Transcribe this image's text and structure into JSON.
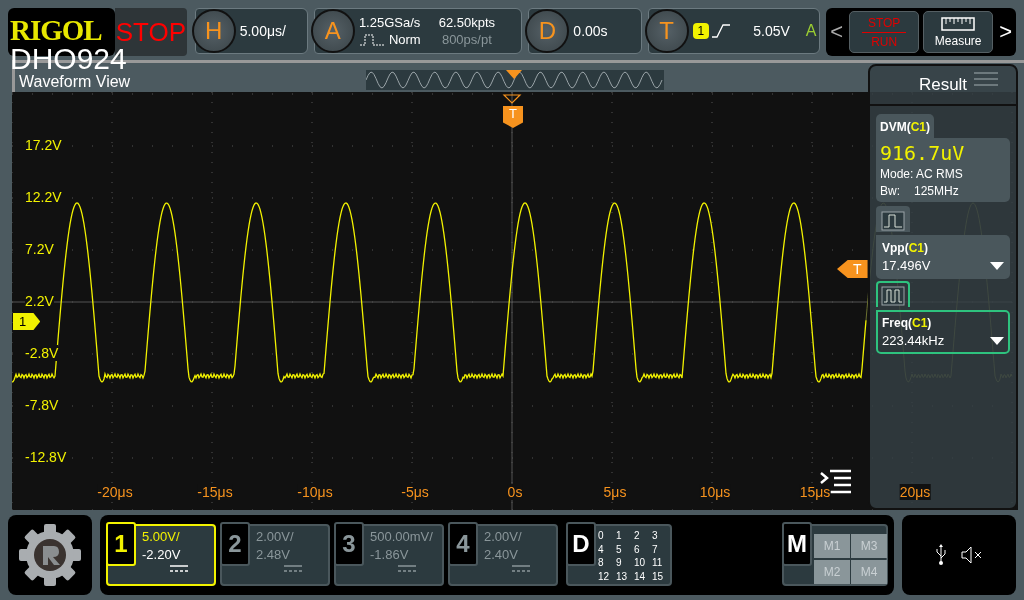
{
  "header": {
    "logo": "RIGOL",
    "model": "DHO924",
    "run_state": "STOP"
  },
  "horizontal": {
    "label": "H",
    "scale": "5.00μs/"
  },
  "acquire": {
    "label": "A",
    "sample_rate": "1.25GSa/s",
    "mode": "Norm",
    "memory": "62.50kpts",
    "resolution": "800ps/pt"
  },
  "delay": {
    "label": "D",
    "offset": "0.00s"
  },
  "trigger": {
    "label": "T",
    "source": "1",
    "level": "5.05V",
    "sweep": "A"
  },
  "quick": {
    "prev": "<",
    "next": ">",
    "buttons": [
      {
        "kind": "stop-run",
        "top": "STOP",
        "bottom": "RUN"
      },
      {
        "kind": "measure",
        "label": "Measure"
      }
    ]
  },
  "waveform_view": {
    "title": "Waveform View",
    "channel_marker": "1",
    "trigger_position_marker": "T",
    "trigger_level_marker": "T",
    "y_labels": [
      "17.2V",
      "12.2V",
      "7.2V",
      "2.2V",
      "-2.8V",
      "-7.8V",
      "-12.8V"
    ],
    "x_labels": [
      "-20μs",
      "-15μs",
      "-10μs",
      "-5μs",
      "0s",
      "5μs",
      "10μs",
      "15μs",
      "20μs"
    ]
  },
  "result": {
    "title": "Result",
    "dvm": {
      "title": "DVM(",
      "channel": "C1",
      "suffix": ")",
      "reading": "916.7uV",
      "mode": "Mode: AC RMS",
      "bandwidth_label": "Bw:",
      "bandwidth": "125MHz"
    },
    "measurements": [
      {
        "name": "Vpp(",
        "channel": "C1",
        "suffix": ")",
        "value": "17.496V",
        "selected": false
      },
      {
        "name": "Freq(",
        "channel": "C1",
        "suffix": ")",
        "value": "223.44kHz",
        "selected": true
      }
    ]
  },
  "channels": [
    {
      "number": "1",
      "scale": "5.00V/",
      "offset": "-2.20V",
      "selected": true
    },
    {
      "number": "2",
      "scale": "2.00V/",
      "offset": "2.48V",
      "selected": false
    },
    {
      "number": "3",
      "scale": "500.00mV/",
      "offset": "-1.86V",
      "selected": false
    },
    {
      "number": "4",
      "scale": "2.00V/",
      "offset": "2.40V",
      "selected": false
    }
  ],
  "digital": {
    "label": "D",
    "bits": [
      "0",
      "1",
      "2",
      "3",
      "4",
      "5",
      "6",
      "7",
      "8",
      "9",
      "10",
      "11",
      "12",
      "13",
      "14",
      "15"
    ]
  },
  "math": {
    "label": "M",
    "items": [
      "M1",
      "M3",
      "M2",
      "M4"
    ]
  }
}
